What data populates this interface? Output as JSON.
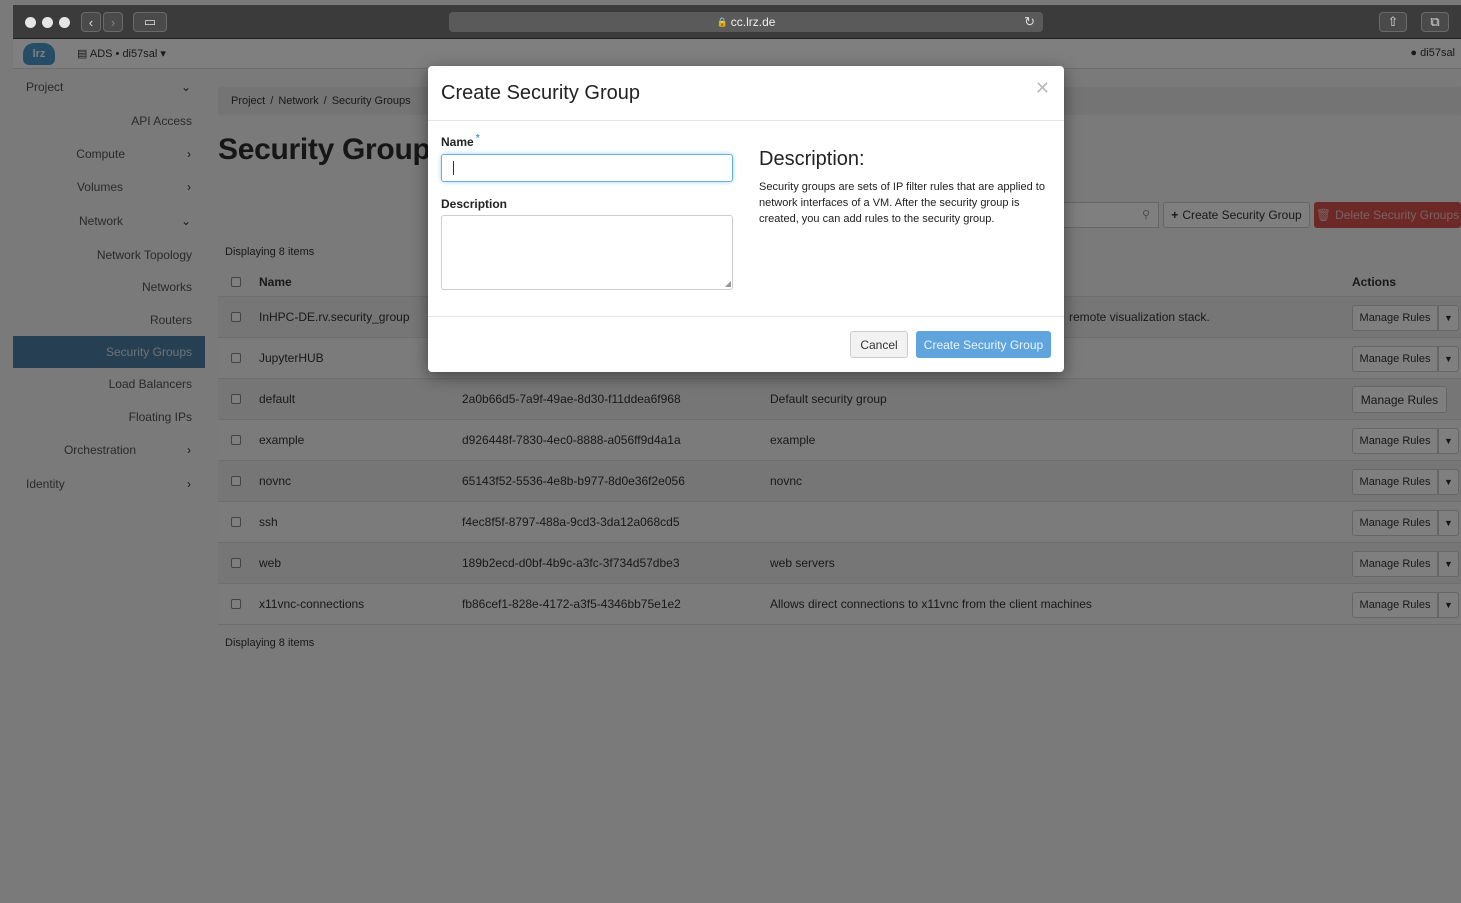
{
  "browser": {
    "url": "cc.lrz.de"
  },
  "navbar": {
    "logo": "lrz",
    "project": "ADS • di57sal",
    "user": "di57sal"
  },
  "sidebar": {
    "items": [
      {
        "label": "Project",
        "chevron": "down"
      },
      {
        "label": "API Access"
      },
      {
        "label": "Compute",
        "chevron": "right"
      },
      {
        "label": "Volumes",
        "chevron": "right"
      },
      {
        "label": "Network",
        "chevron": "down"
      },
      {
        "label": "Network Topology"
      },
      {
        "label": "Networks"
      },
      {
        "label": "Routers"
      },
      {
        "label": "Security Groups",
        "active": true
      },
      {
        "label": "Load Balancers"
      },
      {
        "label": "Floating IPs"
      },
      {
        "label": "Orchestration",
        "chevron": "right"
      },
      {
        "label": "Identity",
        "chevron": "right"
      }
    ]
  },
  "breadcrumb": [
    "Project",
    "/",
    "Network",
    "/",
    "Security Groups"
  ],
  "page_title": "Security Groups",
  "toolbar": {
    "create_label": "Create Security Group",
    "delete_label": "Delete Security Groups"
  },
  "table": {
    "displaying": "Displaying 8 items",
    "headers": {
      "name": "Name",
      "actions": "Actions"
    },
    "rows": [
      {
        "name": "InHPC-DE.rv.security_group",
        "id": "",
        "description": "remote visualization stack.",
        "action": "Manage Rules"
      },
      {
        "name": "JupyterHUB",
        "id": "",
        "description": "",
        "action": "Manage Rules"
      },
      {
        "name": "default",
        "id": "2a0b66d5-7a9f-49ae-8d30-f11ddea6f968",
        "description": "Default security group",
        "action": "Manage Rules"
      },
      {
        "name": "example",
        "id": "d926448f-7830-4ec0-8888-a056ff9d4a1a",
        "description": "example",
        "action": "Manage Rules"
      },
      {
        "name": "novnc",
        "id": "65143f52-5536-4e8b-b977-8d0e36f2e056",
        "description": "novnc",
        "action": "Manage Rules"
      },
      {
        "name": "ssh",
        "id": "f4ec8f5f-8797-488a-9cd3-3da12a068cd5",
        "description": "",
        "action": "Manage Rules"
      },
      {
        "name": "web",
        "id": "189b2ecd-d0bf-4b9c-a3fc-3f734d57dbe3",
        "description": "web servers",
        "action": "Manage Rules"
      },
      {
        "name": "x11vnc-connections",
        "id": "fb86cef1-828e-4172-a3f5-4346bb75e1e2",
        "description": "Allows direct connections to x11vnc from the client machines",
        "action": "Manage Rules"
      }
    ]
  },
  "modal": {
    "title": "Create Security Group",
    "name_label": "Name",
    "name_required": "*",
    "name_value": "",
    "description_label": "Description",
    "description_value": "",
    "help_heading": "Description:",
    "help_text": "Security groups are sets of IP filter rules that are applied to network interfaces of a VM. After the security group is created, you can add rules to the security group.",
    "cancel_label": "Cancel",
    "submit_label": "Create Security Group"
  }
}
